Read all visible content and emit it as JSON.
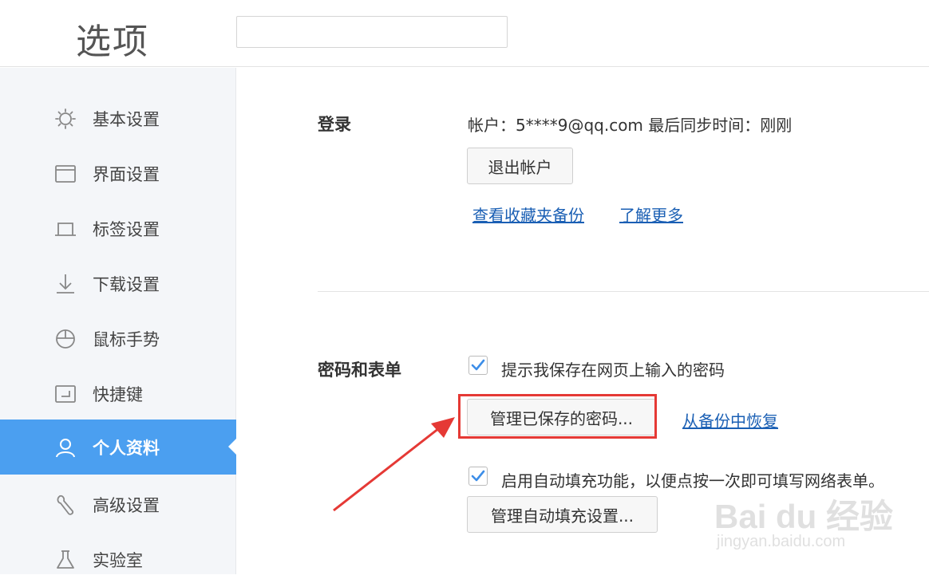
{
  "window": {
    "title": "选项",
    "search_value": ""
  },
  "sidebar": {
    "items": [
      {
        "label": "基本设置",
        "icon": "sun-gear-icon"
      },
      {
        "label": "界面设置",
        "icon": "window-icon"
      },
      {
        "label": "标签设置",
        "icon": "tab-icon"
      },
      {
        "label": "下载设置",
        "icon": "download-icon"
      },
      {
        "label": "鼠标手势",
        "icon": "mouse-icon"
      },
      {
        "label": "快捷键",
        "icon": "keyboard-enter-icon"
      },
      {
        "label": "个人资料",
        "icon": "user-icon",
        "active": true
      },
      {
        "label": "高级设置",
        "icon": "wrench-icon"
      },
      {
        "label": "实验室",
        "icon": "flask-icon"
      }
    ]
  },
  "login": {
    "label": "登录",
    "account_text": "帐户：5****9@qq.com 最后同步时间：刚刚",
    "logout_button": "退出帐户",
    "link_favorites_backup": "查看收藏夹备份",
    "link_learn_more": "了解更多"
  },
  "password": {
    "label": "密码和表单",
    "save_prompt_checkbox": {
      "label": "提示我保存在网页上输入的密码",
      "checked": true
    },
    "manage_passwords_button": "管理已保存的密码...",
    "restore_link": "从备份中恢复",
    "autofill_checkbox": {
      "label": "启用自动填充功能，以便点按一次即可填写网络表单。",
      "checked": true
    },
    "manage_autofill_button": "管理自动填充设置..."
  },
  "watermark": {
    "logo": "Bai du 经验",
    "url": "jingyan.baidu.com"
  },
  "colors": {
    "accent": "#4b9ff0",
    "highlight": "#e53935",
    "link": "#1a5fb4",
    "checkbox": "#3d8ee8"
  }
}
